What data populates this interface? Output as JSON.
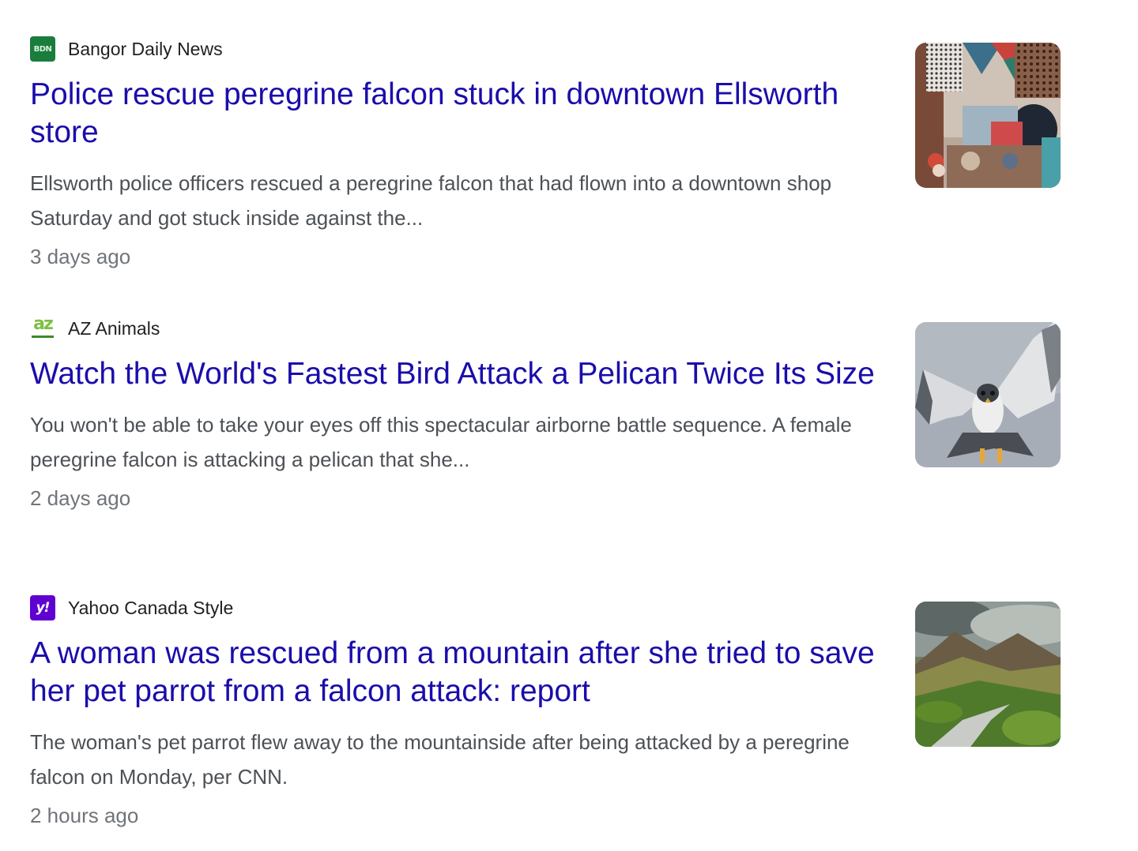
{
  "articles": [
    {
      "source": "Bangor Daily News",
      "favicon": {
        "icon": "bdn-logo-icon",
        "text": "BDN",
        "color": "#1a7d3c"
      },
      "headline": "Police rescue peregrine falcon stuck in downtown Ellsworth store",
      "snippet": "Ellsworth police officers rescued a peregrine falcon that had flown into a downtown shop Saturday and got stuck inside against the...",
      "time": "3 days ago",
      "thumbnail": "store-interior-thumbnail"
    },
    {
      "source": "AZ Animals",
      "favicon": {
        "icon": "az-animals-logo-icon",
        "text": "az",
        "color": "#7cc043"
      },
      "headline": "Watch the World's Fastest Bird Attack a Pelican Twice Its Size",
      "snippet": "You won't be able to take your eyes off this spectacular airborne battle sequence. A female peregrine falcon is attacking a pelican that she...",
      "time": "2 days ago",
      "thumbnail": "peregrine-falcon-thumbnail"
    },
    {
      "source": "Yahoo Canada Style",
      "favicon": {
        "icon": "yahoo-logo-icon",
        "text": "y!",
        "color": "#6001d2"
      },
      "headline": "A woman was rescued from a mountain after she tried to save her pet parrot from a falcon attack: report",
      "snippet": "The woman's pet parrot flew away to the mountainside after being attacked by a peregrine falcon on Monday, per CNN.",
      "time": "2 hours ago",
      "thumbnail": "mountain-landscape-thumbnail"
    }
  ],
  "colors": {
    "headline": "#1a0dab",
    "snippet": "#4d5156",
    "timestamp": "#70757a",
    "source": "#202124"
  }
}
